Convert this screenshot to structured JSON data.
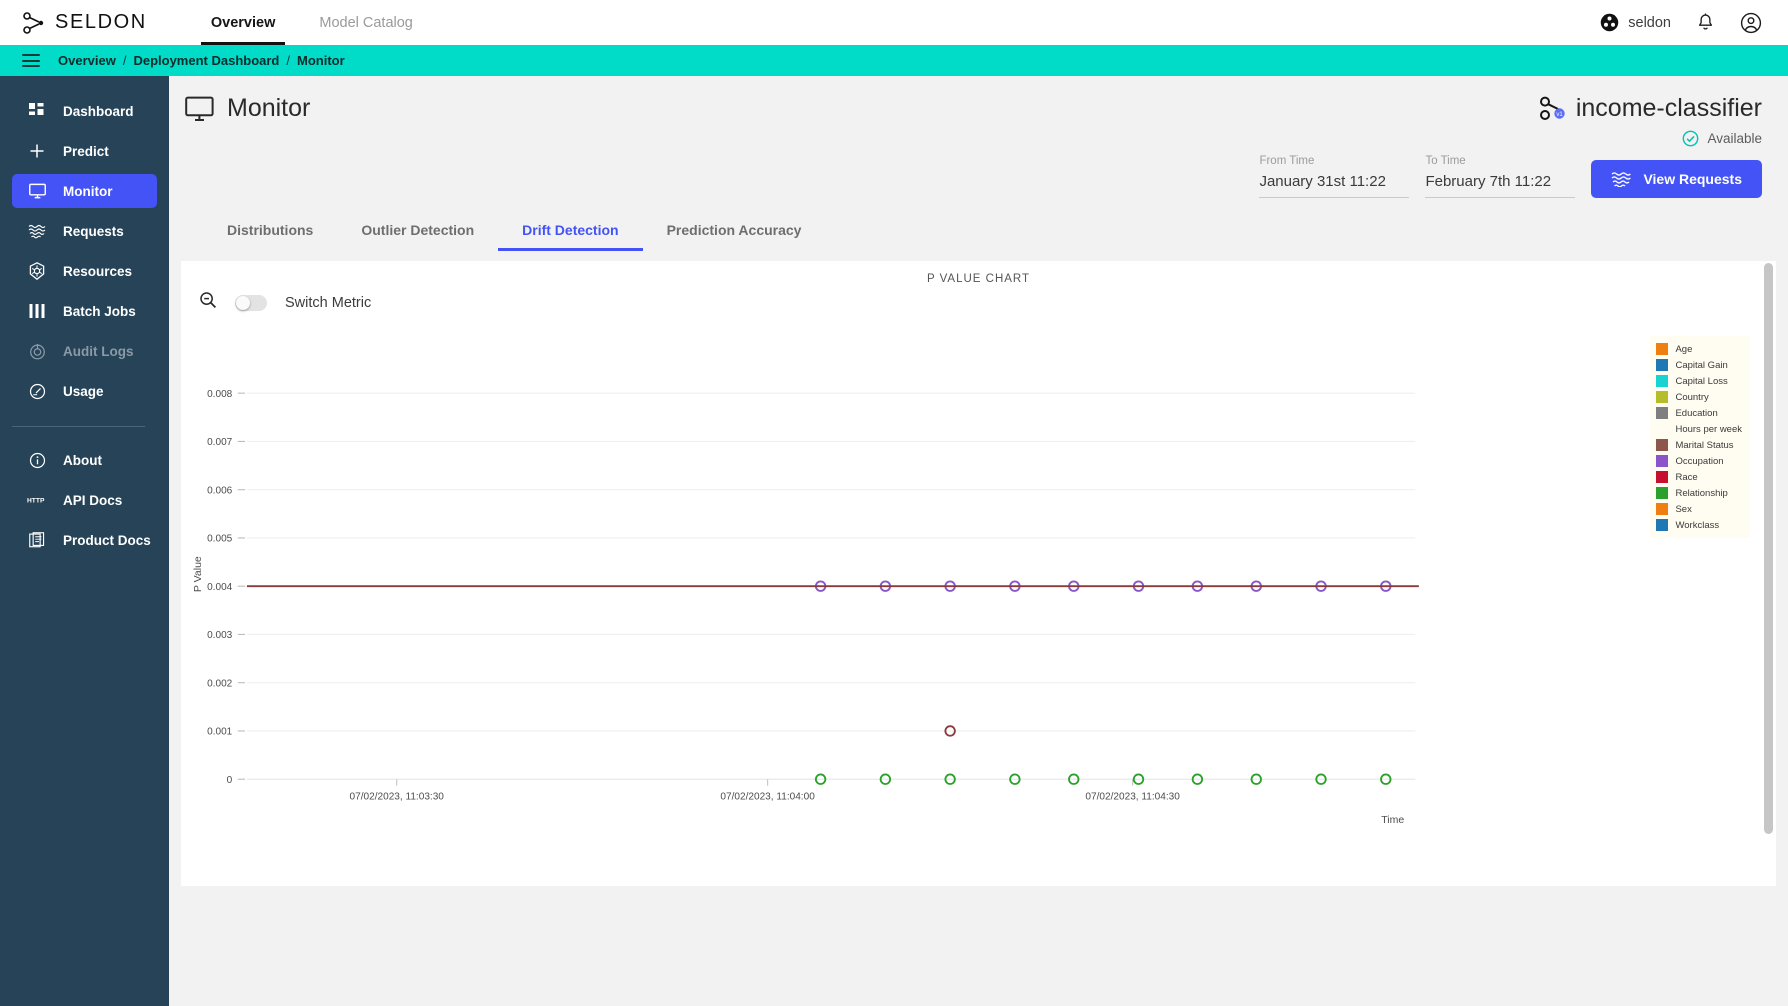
{
  "topbar": {
    "brand_name": "SELDON",
    "brand_logo_icon": "seldon-logo-icon",
    "nav": [
      {
        "label": "Overview",
        "active": true
      },
      {
        "label": "Model Catalog",
        "active": false
      }
    ],
    "org_name": "seldon",
    "org_icon": "org-avatar-icon",
    "notifications_icon": "bell-icon",
    "account_icon": "account-circle-icon"
  },
  "breadcrumb": {
    "menu_icon": "hamburger-menu-icon",
    "items": [
      "Overview",
      "Deployment Dashboard",
      "Monitor"
    ],
    "separator": "/"
  },
  "sidebar": {
    "items": [
      {
        "label": "Dashboard",
        "icon": "dashboard-grid-icon",
        "active": false,
        "disabled": false
      },
      {
        "label": "Predict",
        "icon": "plus-icon",
        "active": false,
        "disabled": false
      },
      {
        "label": "Monitor",
        "icon": "monitor-screen-icon",
        "active": true,
        "disabled": false
      },
      {
        "label": "Requests",
        "icon": "waves-icon",
        "active": false,
        "disabled": false
      },
      {
        "label": "Resources",
        "icon": "kubernetes-icon",
        "active": false,
        "disabled": false
      },
      {
        "label": "Batch Jobs",
        "icon": "bars-icon",
        "active": false,
        "disabled": false
      },
      {
        "label": "Audit Logs",
        "icon": "audit-target-icon",
        "active": false,
        "disabled": true
      },
      {
        "label": "Usage",
        "icon": "gauge-icon",
        "active": false,
        "disabled": false
      }
    ],
    "footer_items": [
      {
        "label": "About",
        "icon": "info-circle-icon"
      },
      {
        "label": "API Docs",
        "icon": "http-text-icon"
      },
      {
        "label": "Product Docs",
        "icon": "documents-icon"
      }
    ]
  },
  "page": {
    "title": "Monitor",
    "title_icon": "monitor-screen-icon",
    "deployment_name": "income-classifier",
    "deployment_icon": "model-graph-icon",
    "status_label": "Available",
    "status_icon": "check-circle-icon",
    "status_color": "#00c4b4"
  },
  "controls": {
    "from_time": {
      "label": "From Time",
      "value": "January 31st 11:22",
      "placeholder": "From Time"
    },
    "to_time": {
      "label": "To Time",
      "value": "February 7th 11:22",
      "placeholder": "To Time"
    },
    "view_requests": {
      "label": "View Requests",
      "icon": "waves-icon",
      "color": "#4353f5"
    }
  },
  "tabs": [
    {
      "label": "Distributions",
      "active": false
    },
    {
      "label": "Outlier Detection",
      "active": false
    },
    {
      "label": "Drift Detection",
      "active": true
    },
    {
      "label": "Prediction Accuracy",
      "active": false
    }
  ],
  "chart_panel": {
    "caption": "P VALUE CHART",
    "zoom_icon": "zoom-out-magnifier-icon",
    "toggle_label": "Switch Metric",
    "toggle_on": false
  },
  "chart_data": {
    "type": "scatter",
    "title": "P VALUE CHART",
    "xlabel": "Time",
    "ylabel": "P Value",
    "ylim": [
      0,
      0.0085
    ],
    "yticks": [
      "0",
      "0.001",
      "0.002",
      "0.003",
      "0.004",
      "0.005",
      "0.006",
      "0.007",
      "0.008"
    ],
    "ytick_values": [
      0,
      0.001,
      0.002,
      0.003,
      0.004,
      0.005,
      0.006,
      0.007,
      0.008
    ],
    "xticks": [
      "07/02/2023, 11:03:30",
      "07/02/2023, 11:04:00",
      "07/02/2023, 11:04:30"
    ],
    "xtick_positions_pct": [
      13.5,
      45.0,
      76.0
    ],
    "grid": true,
    "legend_position": "right",
    "legend": [
      {
        "name": "Age",
        "color": "#f07f12"
      },
      {
        "name": "Capital Gain",
        "color": "#1f77b4"
      },
      {
        "name": "Capital Loss",
        "color": "#19d3d3"
      },
      {
        "name": "Country",
        "color": "#b5bd2a"
      },
      {
        "name": "Education",
        "color": "#7f7f7f"
      },
      {
        "name": "Hours per week",
        "color": "#d martin"
      },
      {
        "name": "Marital Status",
        "color": "#8c564b"
      },
      {
        "name": "Occupation",
        "color": "#8b55c9"
      },
      {
        "name": "Race",
        "color": "#c7102e"
      },
      {
        "name": "Relationship",
        "color": "#2ca02c"
      },
      {
        "name": "Sex",
        "color": "#f07f12"
      },
      {
        "name": "Workclass",
        "color": "#1f77b4"
      }
    ],
    "series": [
      {
        "name": "Occupation",
        "color": "#8b55c9",
        "marker": "open-circle",
        "x_pct": [
          49.5,
          55.0,
          60.5,
          66.0,
          71.0,
          76.5,
          81.5,
          86.5,
          92.0,
          97.5
        ],
        "values": [
          0.004,
          0.004,
          0.004,
          0.004,
          0.004,
          0.004,
          0.004,
          0.004,
          0.004,
          0.004
        ]
      },
      {
        "name": "Race",
        "color": "#8b3a3a",
        "marker": "line-with-circle",
        "line_y": 0.004,
        "x_pct": [
          60.5
        ],
        "values": [
          0.001
        ]
      },
      {
        "name": "Relationship",
        "color": "#2ca02c",
        "marker": "open-circle",
        "x_pct": [
          49.5,
          55.0,
          60.5,
          66.0,
          71.0,
          76.5,
          81.5,
          86.5,
          92.0,
          97.5
        ],
        "values": [
          0,
          0,
          0,
          0,
          0,
          0,
          0,
          0,
          0,
          0
        ]
      }
    ]
  }
}
